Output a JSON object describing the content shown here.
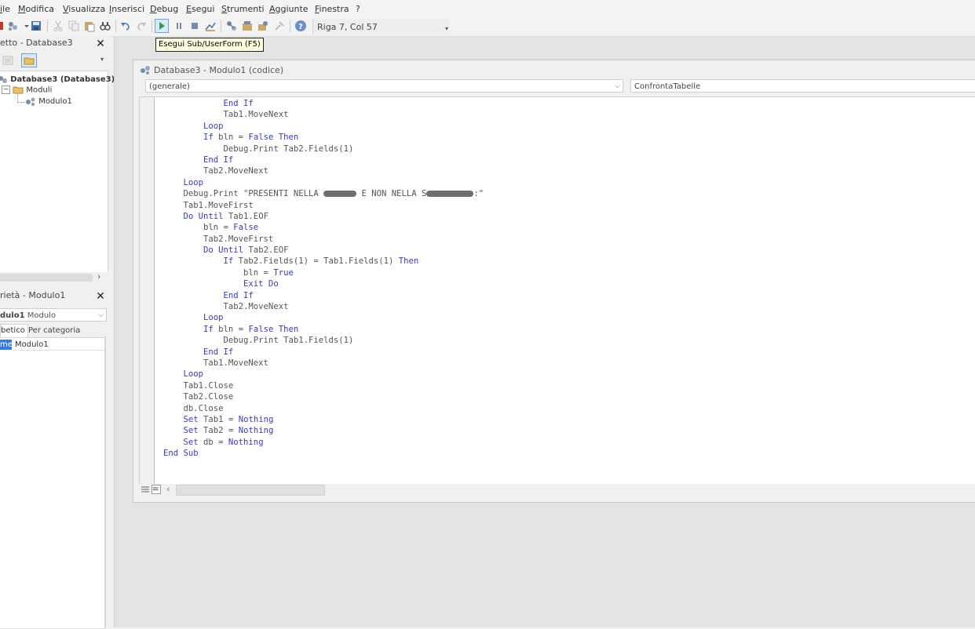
{
  "menu": {
    "items": [
      "ile",
      "Modifica",
      "Visualizza",
      "Inserisci",
      "Debug",
      "Esegui",
      "Strumenti",
      "Aggiunte",
      "Finestra",
      "?"
    ]
  },
  "toolbar": {
    "position": "Riga 7, Col 57",
    "tooltip": "Esegui Sub/UserForm (F5)"
  },
  "project": {
    "title": "etto - Database3",
    "root": "Database3 (Database3)",
    "folder": "Moduli",
    "module": "Modulo1"
  },
  "properties": {
    "title": "rietà - Modulo1",
    "object_name": "dulo1",
    "object_type": "Modulo",
    "tab_alpha": "betico",
    "tab_category": "Per categoria",
    "prop_name": "me)",
    "prop_value": "Modulo1"
  },
  "codewin": {
    "title": "Database3 - Modulo1 (codice)",
    "object_combo": "(generale)",
    "proc_combo": "ConfrontaTabelle"
  },
  "code": {
    "lines": [
      [
        [
          "k",
          "            End If"
        ]
      ],
      [
        [
          "t",
          "            Tab1.MoveNext"
        ]
      ],
      [
        [
          "k",
          "        Loop"
        ]
      ],
      [
        [
          "k",
          "        If "
        ],
        [
          "t",
          "bln = "
        ],
        [
          "k",
          "False Then"
        ]
      ],
      [
        [
          "t",
          "            Debug.Print Tab2.Fields(1)"
        ]
      ],
      [
        [
          "k",
          "        End If"
        ]
      ],
      [
        [
          "t",
          "        Tab2.MoveNext"
        ]
      ],
      [
        [
          "k",
          "    Loop"
        ]
      ],
      [
        [
          "t",
          "    Debug.Print \"PRESENTI NELLA "
        ],
        [
          "blot",
          "42"
        ],
        [
          "t",
          " E NON NELLA S"
        ],
        [
          "blot",
          "60"
        ],
        [
          "t",
          ":\""
        ]
      ],
      [
        [
          "t",
          "    Tab1.MoveFirst"
        ]
      ],
      [
        [
          "k",
          "    Do Until "
        ],
        [
          "t",
          "Tab1.EOF"
        ]
      ],
      [
        [
          "t",
          "        bln = "
        ],
        [
          "k",
          "False"
        ]
      ],
      [
        [
          "t",
          "        Tab2.MoveFirst"
        ]
      ],
      [
        [
          "k",
          "        Do Until "
        ],
        [
          "t",
          "Tab2.EOF"
        ]
      ],
      [
        [
          "k",
          "            If "
        ],
        [
          "t",
          "Tab2.Fields(1) = Tab1.Fields(1) "
        ],
        [
          "k",
          "Then"
        ]
      ],
      [
        [
          "t",
          "                bln = "
        ],
        [
          "k",
          "True"
        ]
      ],
      [
        [
          "k",
          "                Exit Do"
        ]
      ],
      [
        [
          "k",
          "            End If"
        ]
      ],
      [
        [
          "t",
          "            Tab2.MoveNext"
        ]
      ],
      [
        [
          "k",
          "        Loop"
        ]
      ],
      [
        [
          "k",
          "        If "
        ],
        [
          "t",
          "bln = "
        ],
        [
          "k",
          "False Then"
        ]
      ],
      [
        [
          "t",
          "            Debug.Print Tab1.Fields(1)"
        ]
      ],
      [
        [
          "k",
          "        End If"
        ]
      ],
      [
        [
          "t",
          "        Tab1.MoveNext"
        ]
      ],
      [
        [
          "k",
          "    Loop"
        ]
      ],
      [
        [
          "t",
          "    Tab1.Close"
        ]
      ],
      [
        [
          "t",
          "    Tab2.Close"
        ]
      ],
      [
        [
          "t",
          "    db.Close"
        ]
      ],
      [
        [
          "k",
          "    Set "
        ],
        [
          "t",
          "Tab1 = "
        ],
        [
          "k",
          "Nothing"
        ]
      ],
      [
        [
          "k",
          "    Set "
        ],
        [
          "t",
          "Tab2 = "
        ],
        [
          "k",
          "Nothing"
        ]
      ],
      [
        [
          "k",
          "    Set "
        ],
        [
          "t",
          "db = "
        ],
        [
          "k",
          "Nothing"
        ]
      ],
      [
        [
          "k",
          "End Sub"
        ]
      ]
    ]
  },
  "colors": {
    "keyword": "#3b3bb8",
    "text": "#555555"
  }
}
